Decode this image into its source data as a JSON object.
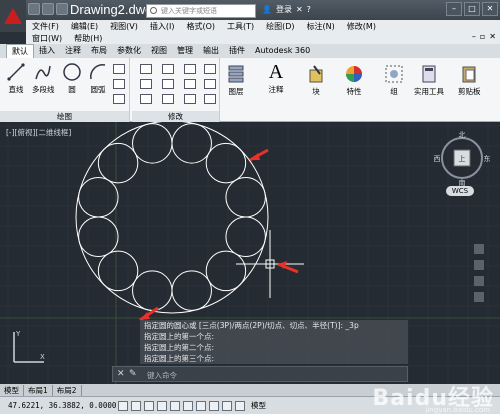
{
  "titlebar": {
    "doc_title": "Drawing2.dwg",
    "search_placeholder": "键入关键字或短语",
    "login": "登录"
  },
  "menu": {
    "row1": [
      "文件(F)",
      "编辑(E)",
      "视图(V)",
      "插入(I)",
      "格式(O)",
      "工具(T)",
      "绘图(D)",
      "标注(N)",
      "修改(M)"
    ],
    "row2": [
      "窗口(W)",
      "帮助(H)"
    ]
  },
  "ribbon": {
    "tabs": [
      "默认",
      "插入",
      "注释",
      "布局",
      "参数化",
      "视图",
      "管理",
      "输出",
      "插件",
      "Autodesk 360"
    ],
    "draw_buttons": [
      "直线",
      "多段线",
      "圆",
      "圆弧"
    ],
    "draw_panel": "绘图",
    "modify_panel": "修改",
    "big_buttons": [
      "图层",
      "注释",
      "块",
      "特性",
      "组",
      "实用工具",
      "剪贴板"
    ]
  },
  "canvas": {
    "viewport_label": "[-][俯视][二维线框]",
    "viewcube": {
      "top": "上",
      "north": "北",
      "south": "南",
      "west": "西",
      "east": "东",
      "wcs": "WCS"
    },
    "circle_count": 12
  },
  "command": {
    "history": [
      "指定圆的圆心或 [三点(3P)/两点(2P)/切点、切点、半径(T)]: _3p",
      "指定圆上的第一个点:",
      "指定圆上的第二个点:",
      "指定圆上的第三个点:"
    ],
    "placeholder": "键入命令"
  },
  "layout_tabs": [
    "模型",
    "布局1",
    "布局2"
  ],
  "status": {
    "coords": "47.6221, 36.3882, 0.0000",
    "model": "模型"
  },
  "watermark": {
    "text": "Baidu经验",
    "sub": "jingyan.baidu.com"
  },
  "colors": {
    "canvas_bg": "#252b32",
    "geometry": "#ffffff",
    "arrow": "#e8312a",
    "grid": "#2f363e"
  }
}
